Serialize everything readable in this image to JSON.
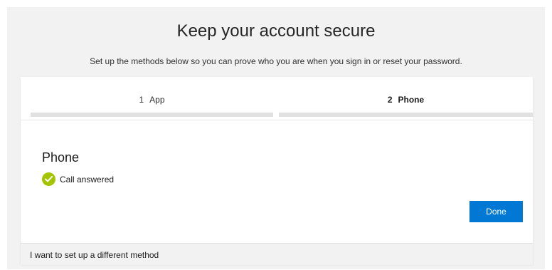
{
  "page": {
    "title": "Keep your account secure",
    "subtitle": "Set up the methods below so you can prove who you are when you sign in or reset your password."
  },
  "steps": [
    {
      "number": "1",
      "label": "App",
      "active": false
    },
    {
      "number": "2",
      "label": "Phone",
      "active": true
    }
  ],
  "method": {
    "title": "Phone",
    "status_text": "Call answered",
    "status_icon": "check-circle-icon",
    "status_color": "#a4c400"
  },
  "actions": {
    "done_label": "Done"
  },
  "footer": {
    "link_text": "I want to set up a different method"
  },
  "colors": {
    "accent": "#0078d4",
    "success": "#a4c400",
    "background": "#f2f2f2"
  }
}
